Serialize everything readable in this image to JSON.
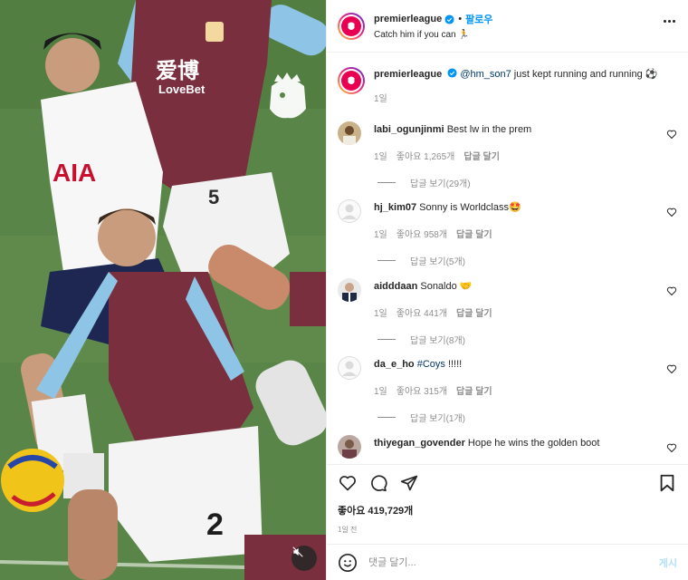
{
  "header": {
    "username": "premierleague",
    "follow_label": "팔로우",
    "dot": "•",
    "subtitle": "Catch him if you can 🏃"
  },
  "caption": {
    "username": "premierleague",
    "mention": "@hm_son7",
    "text": " just kept running and running ⚽",
    "time": "1일"
  },
  "comments": [
    {
      "username": "labi_ogunjinmi",
      "text": "Best lw in the prem",
      "time": "1일",
      "likes": "좋아요 1,265개",
      "reply": "답글 달기",
      "replies": "답글 보기(29개)"
    },
    {
      "username": "hj_kim07",
      "text": "Sonny is Worldclass🤩",
      "time": "1일",
      "likes": "좋아요 958개",
      "reply": "답글 달기",
      "replies": "답글 보기(5개)"
    },
    {
      "username": "aidddaan",
      "text": "Sonaldo 🤝",
      "time": "1일",
      "likes": "좋아요 441개",
      "reply": "답글 달기",
      "replies": "답글 보기(8개)"
    },
    {
      "username": "da_e_ho",
      "hashtag": "#Coys",
      "text": " !!!!!",
      "time": "1일",
      "likes": "좋아요 315개",
      "reply": "답글 달기",
      "replies": "답글 보기(1개)"
    },
    {
      "username": "thiyegan_govender",
      "text": "Hope he wins the golden boot"
    }
  ],
  "actions": {
    "likes": "좋아요 419,729개",
    "posted": "1일 전"
  },
  "add_comment": {
    "placeholder": "댓글 달기...",
    "post_label": "게시"
  },
  "media": {
    "sponsor_text_1": "爱博",
    "sponsor_text_2": "LoveBet",
    "shirt_number_1": "5",
    "shirt_number_2": "2",
    "spurs_text": "AIA"
  },
  "colors": {
    "accent": "#0095f6",
    "brand": "#e90052",
    "burnley_claret": "#7a2f3f",
    "burnley_sky": "#8ec5e6"
  },
  "icons": [
    "verified-icon",
    "more-icon",
    "heart-icon",
    "comment-icon",
    "share-icon",
    "bookmark-icon",
    "emoji-icon",
    "mute-icon"
  ]
}
